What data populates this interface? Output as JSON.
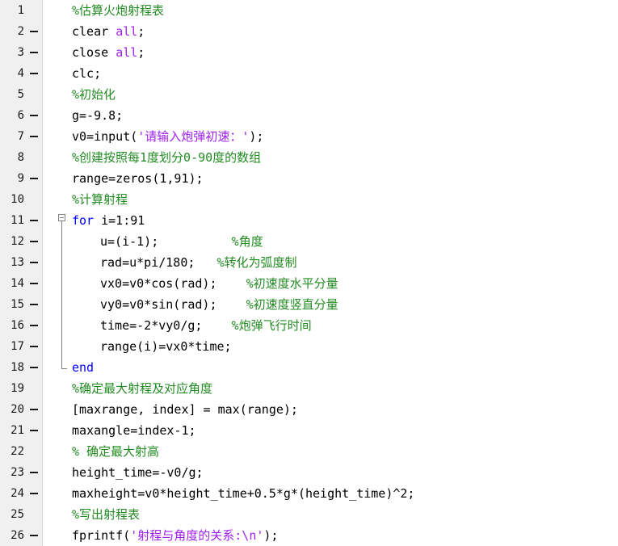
{
  "colors": {
    "keyword": "#0000ff",
    "string": "#a020f0",
    "comment": "#228b22",
    "text": "#000000",
    "gutter": "#f0f0f0"
  },
  "lines": [
    {
      "num": "1",
      "bp": false,
      "indent": 0,
      "tokens": [
        {
          "t": "cm",
          "s": "%估算火炮射程表"
        }
      ]
    },
    {
      "num": "2",
      "bp": true,
      "indent": 0,
      "tokens": [
        {
          "t": "plain",
          "s": "clear "
        },
        {
          "t": "str",
          "s": "all"
        },
        {
          "t": "plain",
          "s": ";"
        }
      ]
    },
    {
      "num": "3",
      "bp": true,
      "indent": 0,
      "tokens": [
        {
          "t": "plain",
          "s": "close "
        },
        {
          "t": "str",
          "s": "all"
        },
        {
          "t": "plain",
          "s": ";"
        }
      ]
    },
    {
      "num": "4",
      "bp": true,
      "indent": 0,
      "tokens": [
        {
          "t": "plain",
          "s": "clc;"
        }
      ]
    },
    {
      "num": "5",
      "bp": false,
      "indent": 0,
      "tokens": [
        {
          "t": "cm",
          "s": "%初始化"
        }
      ]
    },
    {
      "num": "6",
      "bp": true,
      "indent": 0,
      "tokens": [
        {
          "t": "plain",
          "s": "g=-9.8;"
        }
      ]
    },
    {
      "num": "7",
      "bp": true,
      "indent": 0,
      "tokens": [
        {
          "t": "plain",
          "s": "v0=input("
        },
        {
          "t": "str",
          "s": "'请输入炮弹初速：'"
        },
        {
          "t": "plain",
          "s": ");"
        }
      ]
    },
    {
      "num": "8",
      "bp": false,
      "indent": 0,
      "tokens": [
        {
          "t": "cm",
          "s": "%创建按照每1度划分0-90度的数组"
        }
      ]
    },
    {
      "num": "9",
      "bp": true,
      "indent": 0,
      "tokens": [
        {
          "t": "plain",
          "s": "range=zeros(1,91);"
        }
      ]
    },
    {
      "num": "10",
      "bp": false,
      "indent": 0,
      "tokens": [
        {
          "t": "cm",
          "s": "%计算射程"
        }
      ]
    },
    {
      "num": "11",
      "bp": true,
      "indent": 0,
      "tokens": [
        {
          "t": "kw",
          "s": "for"
        },
        {
          "t": "plain",
          "s": " i=1:91"
        }
      ]
    },
    {
      "num": "12",
      "bp": true,
      "indent": 1,
      "tokens": [
        {
          "t": "plain",
          "s": "u=(i-1);          "
        },
        {
          "t": "cm",
          "s": "%角度"
        }
      ]
    },
    {
      "num": "13",
      "bp": true,
      "indent": 1,
      "tokens": [
        {
          "t": "plain",
          "s": "rad=u*pi/180;   "
        },
        {
          "t": "cm",
          "s": "%转化为弧度制"
        }
      ]
    },
    {
      "num": "14",
      "bp": true,
      "indent": 1,
      "tokens": [
        {
          "t": "plain",
          "s": "vx0=v0*cos(rad);    "
        },
        {
          "t": "cm",
          "s": "%初速度水平分量"
        }
      ]
    },
    {
      "num": "15",
      "bp": true,
      "indent": 1,
      "tokens": [
        {
          "t": "plain",
          "s": "vy0=v0*sin(rad);    "
        },
        {
          "t": "cm",
          "s": "%初速度竖直分量"
        }
      ]
    },
    {
      "num": "16",
      "bp": true,
      "indent": 1,
      "tokens": [
        {
          "t": "plain",
          "s": "time=-2*vy0/g;    "
        },
        {
          "t": "cm",
          "s": "%炮弹飞行时间"
        }
      ]
    },
    {
      "num": "17",
      "bp": true,
      "indent": 1,
      "tokens": [
        {
          "t": "plain",
          "s": "range(i)=vx0*time;"
        }
      ]
    },
    {
      "num": "18",
      "bp": true,
      "indent": 0,
      "tokens": [
        {
          "t": "kw",
          "s": "end"
        }
      ]
    },
    {
      "num": "19",
      "bp": false,
      "indent": 0,
      "tokens": [
        {
          "t": "cm",
          "s": "%确定最大射程及对应角度"
        }
      ]
    },
    {
      "num": "20",
      "bp": true,
      "indent": 0,
      "tokens": [
        {
          "t": "plain",
          "s": "[maxrange, index] = max(range);"
        }
      ]
    },
    {
      "num": "21",
      "bp": true,
      "indent": 0,
      "tokens": [
        {
          "t": "plain",
          "s": "maxangle=index-1;"
        }
      ]
    },
    {
      "num": "22",
      "bp": false,
      "indent": 0,
      "tokens": [
        {
          "t": "cm",
          "s": "% 确定最大射高"
        }
      ]
    },
    {
      "num": "23",
      "bp": true,
      "indent": 0,
      "tokens": [
        {
          "t": "plain",
          "s": "height_time=-v0/g;"
        }
      ]
    },
    {
      "num": "24",
      "bp": true,
      "indent": 0,
      "tokens": [
        {
          "t": "plain",
          "s": "maxheight=v0*height_time+0.5*g*(height_time)^2;"
        }
      ]
    },
    {
      "num": "25",
      "bp": false,
      "indent": 0,
      "tokens": [
        {
          "t": "cm",
          "s": "%写出射程表"
        }
      ]
    },
    {
      "num": "26",
      "bp": true,
      "indent": 0,
      "tokens": [
        {
          "t": "plain",
          "s": "fprintf("
        },
        {
          "t": "str",
          "s": "'射程与角度的关系:\\n'"
        },
        {
          "t": "plain",
          "s": ");"
        }
      ]
    }
  ]
}
